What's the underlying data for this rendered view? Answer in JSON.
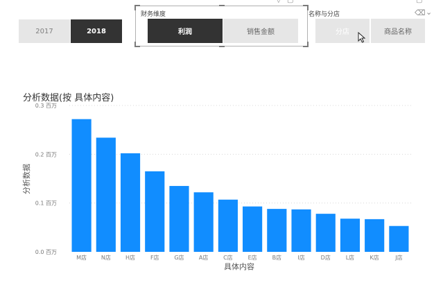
{
  "year_slicer": {
    "items": [
      {
        "label": "2017",
        "selected": false
      },
      {
        "label": "2018",
        "selected": true
      }
    ]
  },
  "finance_slicer": {
    "title": "财务维度",
    "items": [
      {
        "label": "利润",
        "selected": true
      },
      {
        "label": "销售金额",
        "selected": false
      }
    ]
  },
  "dimension_slicer": {
    "title": "名称与分店",
    "items": [
      {
        "label": "分店"
      },
      {
        "label": "商品名称"
      }
    ]
  },
  "colors": {
    "bar": "#118DFF",
    "selected_bg": "#333333",
    "unselected_bg": "#E6E6E6"
  },
  "chart_data": {
    "type": "bar",
    "title": "分析数据(按 具体内容)",
    "xlabel": "具体内容",
    "ylabel": "分析数据",
    "categories": [
      "M店",
      "N店",
      "H店",
      "F店",
      "G店",
      "A店",
      "C店",
      "E店",
      "B店",
      "I店",
      "D店",
      "L店",
      "K店",
      "J店"
    ],
    "values": [
      0.272,
      0.234,
      0.202,
      0.165,
      0.135,
      0.122,
      0.107,
      0.093,
      0.088,
      0.087,
      0.078,
      0.068,
      0.067,
      0.053
    ],
    "yticks": [
      {
        "value": 0,
        "label": "0.0 百万"
      },
      {
        "value": 0.1,
        "label": "0.1 百万"
      },
      {
        "value": 0.2,
        "label": "0.2 百万"
      },
      {
        "value": 0.3,
        "label": "0.3 百万"
      }
    ],
    "ylim": [
      0,
      0.3
    ],
    "grid": true,
    "unit": "百万"
  }
}
